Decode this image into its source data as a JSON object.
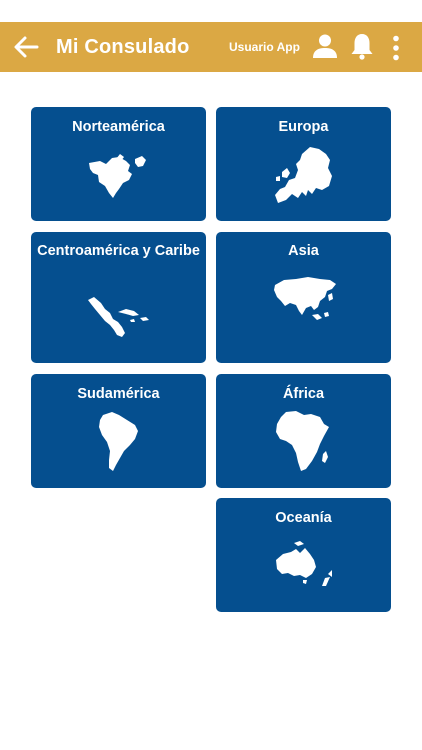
{
  "header": {
    "title": "Mi Consulado",
    "user_label": "Usuario App"
  },
  "regions": [
    {
      "label": "Norteamérica"
    },
    {
      "label": "Europa"
    },
    {
      "label": "Centroamérica y Caribe"
    },
    {
      "label": "Asia"
    },
    {
      "label": "Sudamérica"
    },
    {
      "label": "África"
    },
    {
      "label": "Oceanía"
    }
  ],
  "colors": {
    "header": "#dba844",
    "tile": "#054f8f",
    "text": "#ffffff"
  }
}
